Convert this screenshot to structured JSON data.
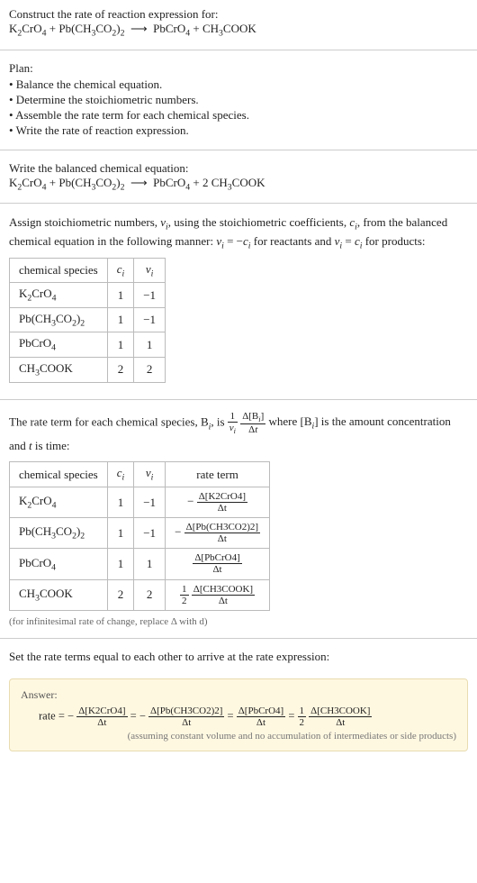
{
  "header": {
    "title": "Construct the rate of reaction expression for:",
    "equation_html": "K<sub>2</sub>CrO<sub>4</sub> + Pb(CH<sub>3</sub>CO<sub>2</sub>)<sub>2</sub> &nbsp;⟶&nbsp; PbCrO<sub>4</sub> + CH<sub>3</sub>COOK"
  },
  "plan": {
    "label": "Plan:",
    "items": [
      "• Balance the chemical equation.",
      "• Determine the stoichiometric numbers.",
      "• Assemble the rate term for each chemical species.",
      "• Write the rate of reaction expression."
    ]
  },
  "balanced": {
    "label": "Write the balanced chemical equation:",
    "equation_html": "K<sub>2</sub>CrO<sub>4</sub> + Pb(CH<sub>3</sub>CO<sub>2</sub>)<sub>2</sub> &nbsp;⟶&nbsp; PbCrO<sub>4</sub> + 2 CH<sub>3</sub>COOK"
  },
  "stoich": {
    "intro_html": "Assign stoichiometric numbers, <i>ν<sub>i</sub></i>, using the stoichiometric coefficients, <i>c<sub>i</sub></i>, from the balanced chemical equation in the following manner: <i>ν<sub>i</sub></i> = −<i>c<sub>i</sub></i> for reactants and <i>ν<sub>i</sub></i> = <i>c<sub>i</sub></i> for products:",
    "headers": [
      "chemical species",
      "c_i",
      "ν_i"
    ],
    "rows": [
      {
        "species_html": "K<sub>2</sub>CrO<sub>4</sub>",
        "c": "1",
        "nu": "−1"
      },
      {
        "species_html": "Pb(CH<sub>3</sub>CO<sub>2</sub>)<sub>2</sub>",
        "c": "1",
        "nu": "−1"
      },
      {
        "species_html": "PbCrO<sub>4</sub>",
        "c": "1",
        "nu": "1"
      },
      {
        "species_html": "CH<sub>3</sub>COOK",
        "c": "2",
        "nu": "2"
      }
    ]
  },
  "rate_term": {
    "intro_pre": "The rate term for each chemical species, B",
    "intro_mid": ", is ",
    "intro_post_html": " where [B<sub><i>i</i></sub>] is the amount concentration and <i>t</i> is time:",
    "headers": [
      "chemical species",
      "c_i",
      "ν_i",
      "rate term"
    ],
    "rows": [
      {
        "species_html": "K<sub>2</sub>CrO<sub>4</sub>",
        "c": "1",
        "nu": "−1",
        "term_num": "Δ[K2CrO4]",
        "term_den": "Δt",
        "prefix": "−",
        "coef_num": "",
        "coef_den": ""
      },
      {
        "species_html": "Pb(CH<sub>3</sub>CO<sub>2</sub>)<sub>2</sub>",
        "c": "1",
        "nu": "−1",
        "term_num": "Δ[Pb(CH3CO2)2]",
        "term_den": "Δt",
        "prefix": "−",
        "coef_num": "",
        "coef_den": ""
      },
      {
        "species_html": "PbCrO<sub>4</sub>",
        "c": "1",
        "nu": "1",
        "term_num": "Δ[PbCrO4]",
        "term_den": "Δt",
        "prefix": "",
        "coef_num": "",
        "coef_den": ""
      },
      {
        "species_html": "CH<sub>3</sub>COOK",
        "c": "2",
        "nu": "2",
        "term_num": "Δ[CH3COOK]",
        "term_den": "Δt",
        "prefix": "",
        "coef_num": "1",
        "coef_den": "2"
      }
    ],
    "note": "(for infinitesimal rate of change, replace Δ with d)"
  },
  "final": {
    "label": "Set the rate terms equal to each other to arrive at the rate expression:"
  },
  "answer": {
    "label": "Answer:",
    "expr_parts": [
      {
        "pre": "rate = −",
        "num": "Δ[K2CrO4]",
        "den": "Δt"
      },
      {
        "pre": " = −",
        "num": "Δ[Pb(CH3CO2)2]",
        "den": "Δt"
      },
      {
        "pre": " = ",
        "num": "Δ[PbCrO4]",
        "den": "Δt"
      },
      {
        "pre": " = ",
        "coef_num": "1",
        "coef_den": "2",
        "num": "Δ[CH3COOK]",
        "den": "Δt"
      }
    ],
    "note": "(assuming constant volume and no accumulation of intermediates or side products)"
  },
  "chart_data": {
    "type": "table",
    "tables": [
      {
        "title": "stoichiometric numbers",
        "columns": [
          "chemical species",
          "c_i",
          "ν_i"
        ],
        "rows": [
          [
            "K2CrO4",
            1,
            -1
          ],
          [
            "Pb(CH3CO2)2",
            1,
            -1
          ],
          [
            "PbCrO4",
            1,
            1
          ],
          [
            "CH3COOK",
            2,
            2
          ]
        ]
      },
      {
        "title": "rate terms",
        "columns": [
          "chemical species",
          "c_i",
          "ν_i",
          "rate term"
        ],
        "rows": [
          [
            "K2CrO4",
            1,
            -1,
            "-Δ[K2CrO4]/Δt"
          ],
          [
            "Pb(CH3CO2)2",
            1,
            -1,
            "-Δ[Pb(CH3CO2)2]/Δt"
          ],
          [
            "PbCrO4",
            1,
            1,
            "Δ[PbCrO4]/Δt"
          ],
          [
            "CH3COOK",
            2,
            2,
            "(1/2)Δ[CH3COOK]/Δt"
          ]
        ]
      }
    ]
  }
}
